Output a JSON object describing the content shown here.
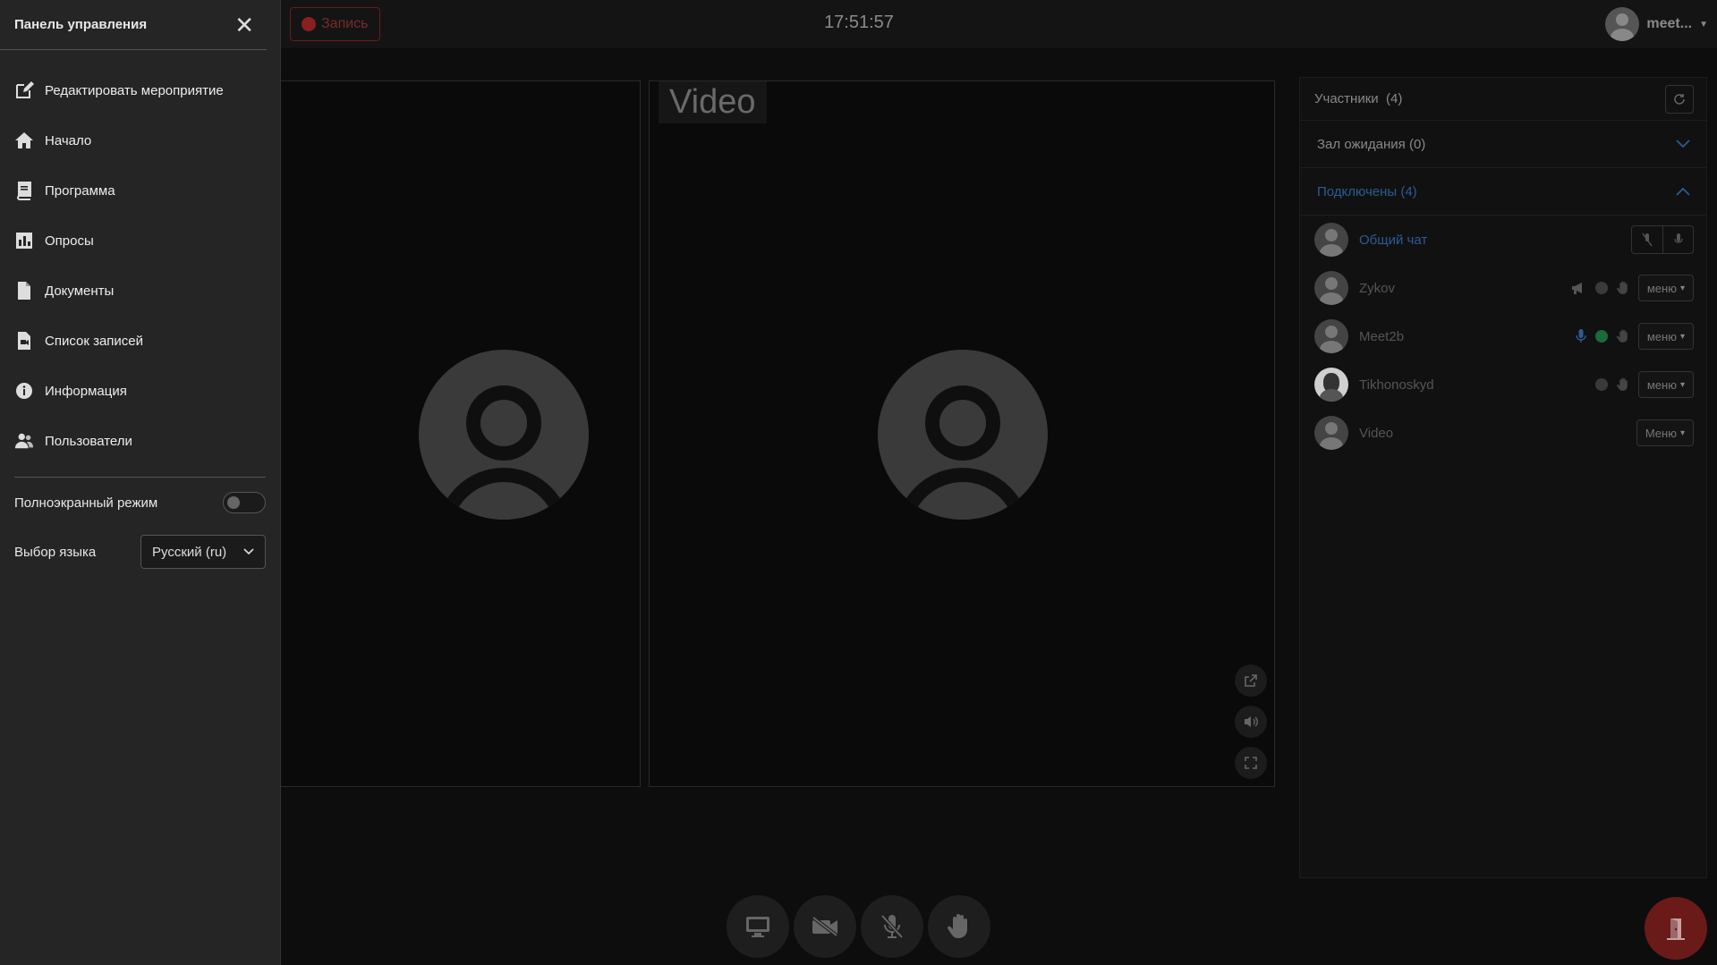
{
  "topbar": {
    "record_label": "Запись",
    "clock": "17:51:57",
    "user_name": "meet..."
  },
  "tiles": {
    "right_label": "Video"
  },
  "participants": {
    "title": "Участники",
    "count": "(4)",
    "waiting_room": "Зал ожидания (0)",
    "connected": "Подключены (4)",
    "rows": [
      {
        "name": "Общий чат"
      },
      {
        "name": "Zykov",
        "menu": "меню"
      },
      {
        "name": "Meet2b",
        "menu": "меню"
      },
      {
        "name": "Tikhonoskyd",
        "menu": "меню"
      },
      {
        "name": "Video",
        "menu": "Меню"
      }
    ]
  },
  "sidemenu": {
    "title": "Панель управления",
    "items": [
      {
        "label": "Редактировать мероприятие",
        "icon": "edit-icon"
      },
      {
        "label": "Начало",
        "icon": "home-icon"
      },
      {
        "label": "Программа",
        "icon": "book-icon"
      },
      {
        "label": "Опросы",
        "icon": "chart-icon"
      },
      {
        "label": "Документы",
        "icon": "document-icon"
      },
      {
        "label": "Список записей",
        "icon": "recordings-icon"
      },
      {
        "label": "Информация",
        "icon": "info-icon"
      },
      {
        "label": "Пользователи",
        "icon": "users-icon"
      }
    ],
    "fullscreen_label": "Полноэкранный режим",
    "language_label": "Выбор языка",
    "language_value": "Русский (ru)"
  },
  "colors": {
    "accent_blue": "#2d5b96",
    "danger_red": "#6b1a1a",
    "green_status": "#1a6a3a"
  }
}
